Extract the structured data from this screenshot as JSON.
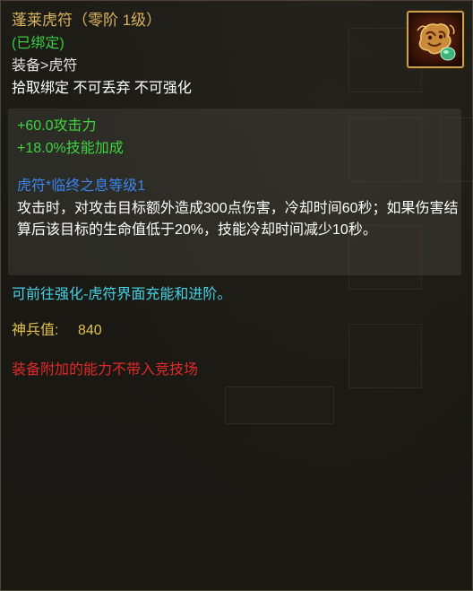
{
  "item": {
    "name": "蓬莱虎符（零阶 1级）",
    "bound_status": "(已绑定)",
    "category": "装备>虎符",
    "restrictions": "拾取绑定 不可丢弃 不可强化",
    "icon": "tiger-talisman-icon"
  },
  "stats": [
    "+60.0攻击力",
    "+18.0%技能加成"
  ],
  "skill": {
    "name": "虎符*临终之息等级1",
    "description": "攻击时，对攻击目标额外造成300点伤害，冷却时间60秒；如果伤害结算后该目标的生命值低于20%，技能冷却时间减少10秒。"
  },
  "hint": "可前往强化-虎符界面充能和进阶。",
  "divine_power": {
    "label": "神兵值:",
    "value": "840"
  },
  "warning": "装备附加的能力不带入竞技场",
  "colors": {
    "title": "#d8b25e",
    "bound": "#3fc93f",
    "stat": "#3fd33f",
    "skill_name": "#3a86f0",
    "hint": "#45d2e6",
    "divine_power": "#e2c24a",
    "warning": "#e02a2a"
  }
}
